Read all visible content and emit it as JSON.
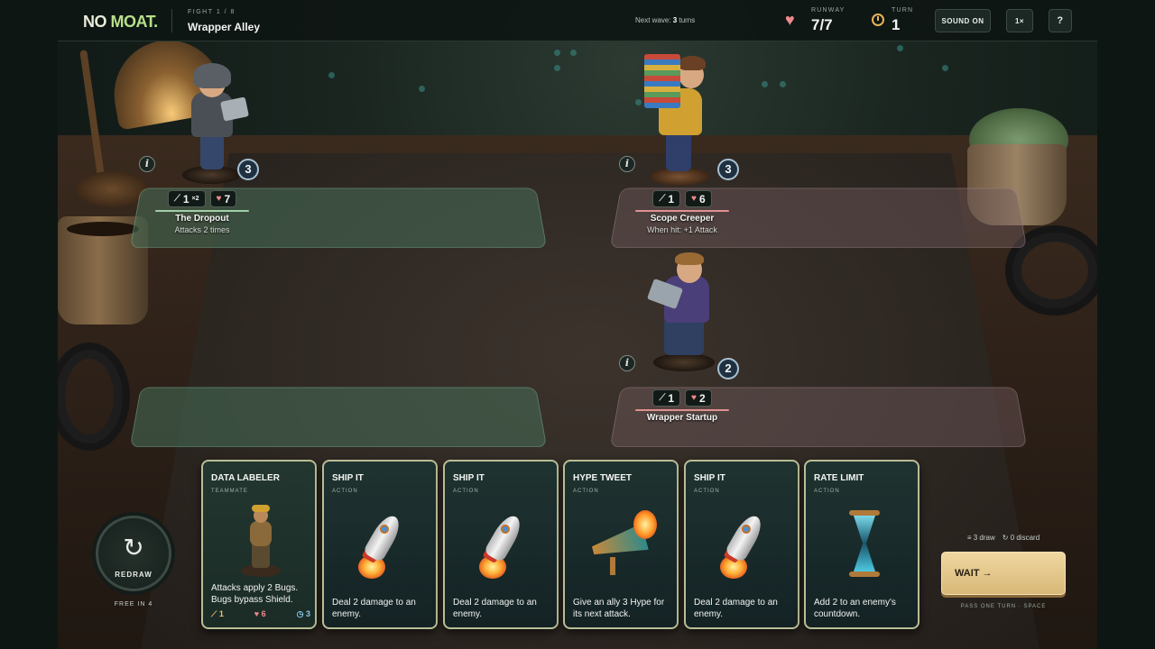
{
  "topbar": {
    "logo_part1": "NO ",
    "logo_part2": "MOAT.",
    "fight_label": "FIGHT 1 / 8",
    "fight_name": "Wrapper Alley",
    "next_wave_prefix": "Next wave: ",
    "next_wave_value": "3",
    "next_wave_suffix": " turns",
    "runway_label": "RUNWAY",
    "runway_value": "7/7",
    "turn_label": "TURN",
    "turn_value": "1",
    "sound_button": "SOUND ON",
    "speed_button": "1×",
    "help_button": "?"
  },
  "board": {
    "ally_units": [
      {
        "name": "The Dropout",
        "ability": "Attacks 2 times",
        "attack": "1",
        "attack_multiplier": "×2",
        "health": "7",
        "cost": "3",
        "info": "i"
      }
    ],
    "enemy_units": [
      {
        "name": "Scope Creeper",
        "ability": "When hit: +1 Attack",
        "attack": "1",
        "health": "6",
        "cost": "3",
        "info": "i"
      },
      {
        "name": "Wrapper Startup",
        "attack": "1",
        "health": "2",
        "cost": "2",
        "info": "i"
      }
    ]
  },
  "hand": [
    {
      "title": "DATA LABELER",
      "type": "TEAMMATE",
      "text": "Attacks apply 2 Bugs. Bugs bypass Shield.",
      "attack": "1",
      "health": "6",
      "countdown": "3",
      "art": "figure"
    },
    {
      "title": "SHIP IT",
      "type": "ACTION",
      "text": "Deal 2 damage to an enemy.",
      "art": "rocket-icon"
    },
    {
      "title": "SHIP IT",
      "type": "ACTION",
      "text": "Deal 2 damage to an enemy.",
      "art": "rocket-icon"
    },
    {
      "title": "HYPE TWEET",
      "type": "ACTION",
      "text": "Give an ally 3 Hype for its next attack.",
      "art": "megaphone-icon"
    },
    {
      "title": "SHIP IT",
      "type": "ACTION",
      "text": "Deal 2 damage to an enemy.",
      "art": "rocket-icon"
    },
    {
      "title": "RATE LIMIT",
      "type": "ACTION",
      "text": "Add 2 to an enemy's countdown.",
      "art": "hourglass-icon"
    }
  ],
  "controls": {
    "redraw_label": "REDRAW",
    "free_in": "FREE IN 4",
    "draw_count": "3 draw",
    "discard_count": "0 discard",
    "wait_label": "WAIT →",
    "wait_hint": "PASS ONE TURN · SPACE"
  },
  "colors": {
    "accent_green": "#b8e08a",
    "ally_lane": "#466e58",
    "enemy_lane": "#6e585a",
    "wait_button": "#e6c88c",
    "health": "#f08a8a"
  }
}
